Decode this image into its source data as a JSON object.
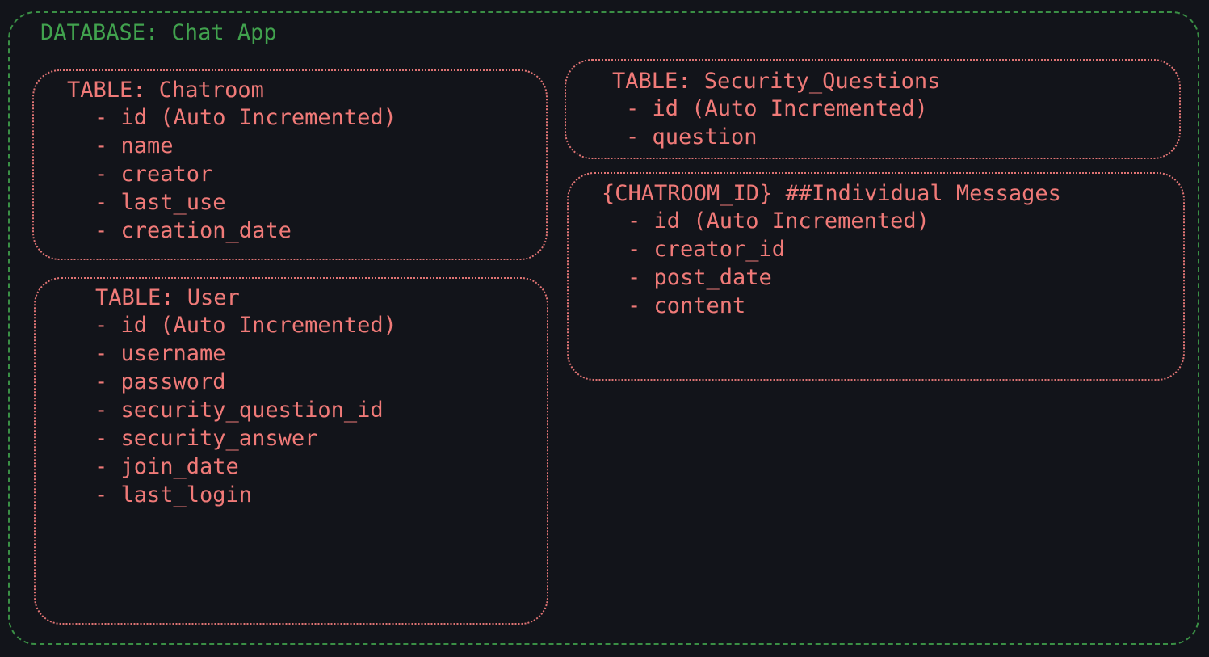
{
  "database": {
    "title": "DATABASE: Chat App"
  },
  "tables": {
    "chatroom": {
      "title": "TABLE: Chatroom",
      "fields": [
        "- id (Auto Incremented)",
        "- name",
        "- creator",
        "- last_use",
        "- creation_date"
      ]
    },
    "user": {
      "title": "TABLE: User",
      "fields": [
        "- id (Auto Incremented)",
        "- username",
        "- password",
        "- security_question_id",
        "- security_answer",
        "- join_date",
        "- last_login"
      ]
    },
    "security_questions": {
      "title": "TABLE: Security_Questions",
      "fields": [
        "- id (Auto Incremented)",
        "- question"
      ]
    },
    "messages": {
      "title": "{CHATROOM_ID} ##Individual Messages",
      "fields": [
        "- id (Auto Incremented)",
        "- creator_id",
        "- post_date",
        "- content"
      ]
    }
  },
  "colors": {
    "background": "#12141a",
    "database_border": "#3a8f45",
    "database_text": "#41a24e",
    "table_border": "#e07474",
    "table_text": "#f07a78"
  }
}
